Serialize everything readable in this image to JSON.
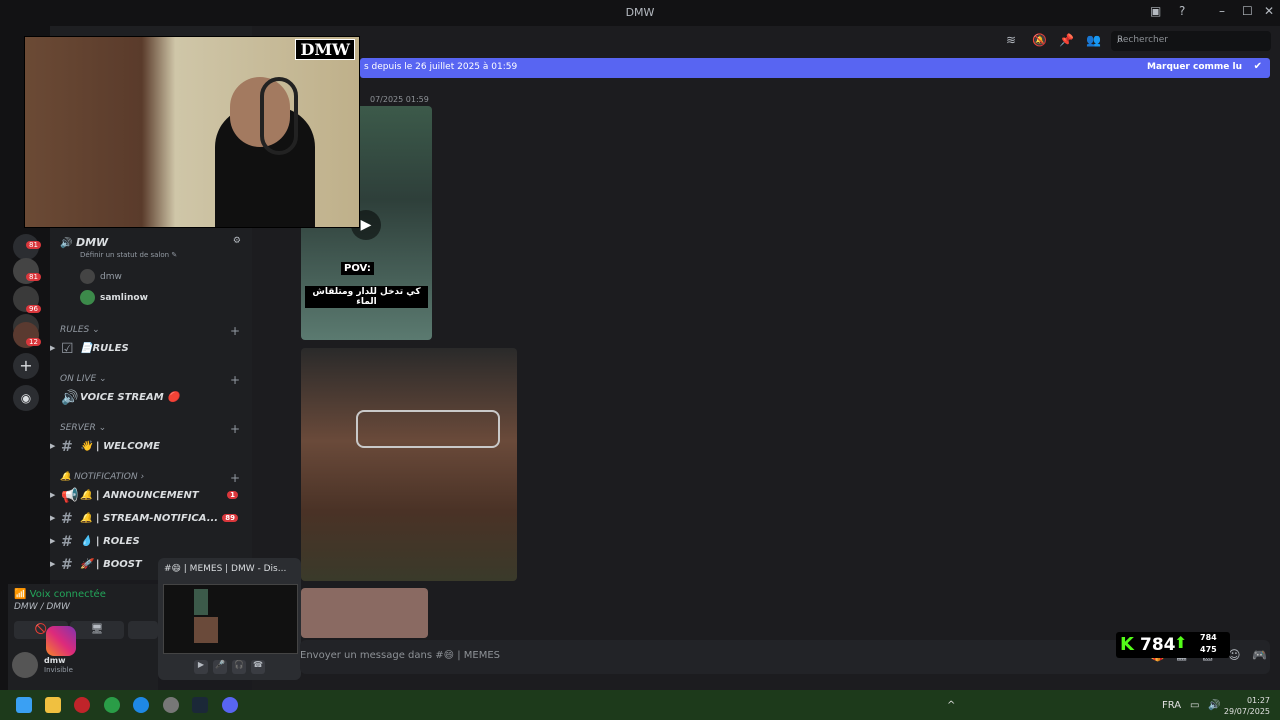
{
  "window": {
    "title": "DMW",
    "minimize": "–",
    "maximize": "☐",
    "close": "✕"
  },
  "toolbar": {
    "search_placeholder": "Rechercher"
  },
  "unread_banner": {
    "text": "s depuis le 26 juillet 2025 à 01:59",
    "action": "Marquer comme lu"
  },
  "message": {
    "timestamp": "07/2025 01:59",
    "media1_caption_pov": "POV:",
    "media1_caption_arabic": "كي تدخل للدار ومتلقاش الماء"
  },
  "webcam": {
    "overlay_logo": "DMW"
  },
  "server": {
    "name": "DMW",
    "status_prompt": "Définir un statut de salon ✎",
    "voice_users": [
      "dmw",
      "samlinow"
    ]
  },
  "rail_badges": [
    "81",
    "81",
    "96",
    "12"
  ],
  "categories": [
    {
      "label": "RULES ⌄"
    },
    {
      "label": "ON LIVE ⌄"
    },
    {
      "label": "SERVER ⌄"
    },
    {
      "label": "🔔 NOTIFICATION ›"
    }
  ],
  "channels": [
    {
      "icon": "☑",
      "label": "📄RULES",
      "badge": ""
    },
    {
      "icon": "🔊",
      "label": "VOICE STREAM 🔴",
      "badge": ""
    },
    {
      "icon": "#",
      "label": "👋 | WELCOME",
      "badge": ""
    },
    {
      "icon": "📢",
      "label": "🔔 | ANNOUNCEMENT",
      "badge": "1"
    },
    {
      "icon": "#",
      "label": "🔔 | STREAM-NOTIFICA...",
      "badge": "89"
    },
    {
      "icon": "#",
      "label": "💧 | ROLES",
      "badge": ""
    },
    {
      "icon": "#",
      "label": "🚀 | BOOST",
      "badge": ""
    }
  ],
  "voice_panel": {
    "status": "Voix connectée",
    "location": "DMW / DMW",
    "user": "dmw",
    "user_status": "Invisible"
  },
  "popup": {
    "title": "#😄 | MEMES | DMW - Dis..."
  },
  "composer": {
    "placeholder": "Envoyer un message dans #😄 | MEMES"
  },
  "kick_overlay": {
    "count": "784",
    "up": "784",
    "down": "475"
  },
  "taskbar": {
    "lang": "FRA",
    "time": "01:27",
    "date": "29/07/2025"
  }
}
